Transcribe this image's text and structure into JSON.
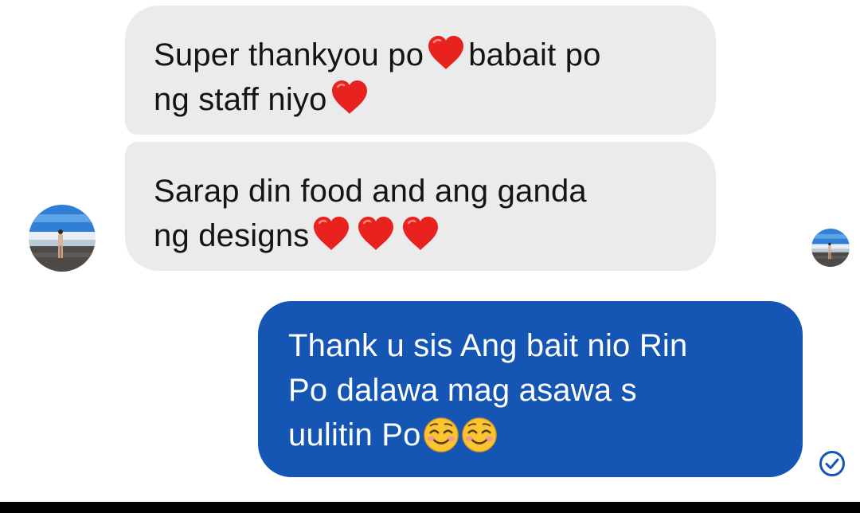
{
  "conversation": {
    "messages": [
      {
        "sender": "contact",
        "lines": [
          "Super thankyou po",
          "babait po",
          "ng staff niyo"
        ],
        "emoji": "heart-icon"
      },
      {
        "sender": "contact",
        "lines": [
          "Sarap din food and ang ganda",
          "ng designs"
        ],
        "emoji": "heart-icon"
      },
      {
        "sender": "me",
        "lines": [
          "Thank u sis Ang bait nio Rin",
          "Po dalawa mag asawa s",
          "uulitin Po"
        ],
        "emoji": "smiling-face-icon"
      }
    ],
    "read_receipt": "check-circle-icon"
  },
  "colors": {
    "incoming_bubble": "#ebebeb",
    "outgoing_bubble": "#1555b3",
    "heart": "#e8231f",
    "read_icon": "#1555b3"
  }
}
